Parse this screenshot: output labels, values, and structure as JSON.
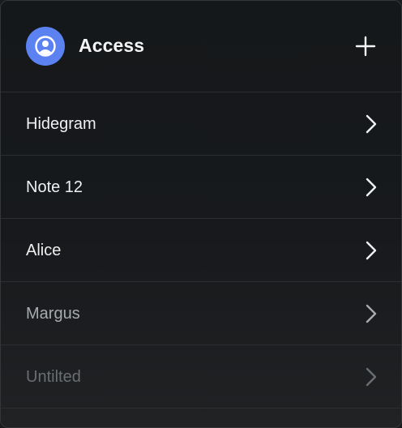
{
  "header": {
    "title": "Access",
    "avatar_icon": "user-circle-icon",
    "add_icon": "plus-icon",
    "avatar_color": "#5b82f0"
  },
  "items": [
    {
      "label": "Hidegram",
      "icon": "chevron-right-icon",
      "color": "#eef0f1"
    },
    {
      "label": "Note 12",
      "icon": "chevron-right-icon",
      "color": "#eef0f1"
    },
    {
      "label": "Alice",
      "icon": "chevron-right-icon",
      "color": "#eef0f1"
    },
    {
      "label": "Margus",
      "icon": "chevron-right-icon",
      "color": "#a7abaf"
    },
    {
      "label": "Untilted",
      "icon": "chevron-right-icon",
      "color": "#6a6e72"
    }
  ]
}
